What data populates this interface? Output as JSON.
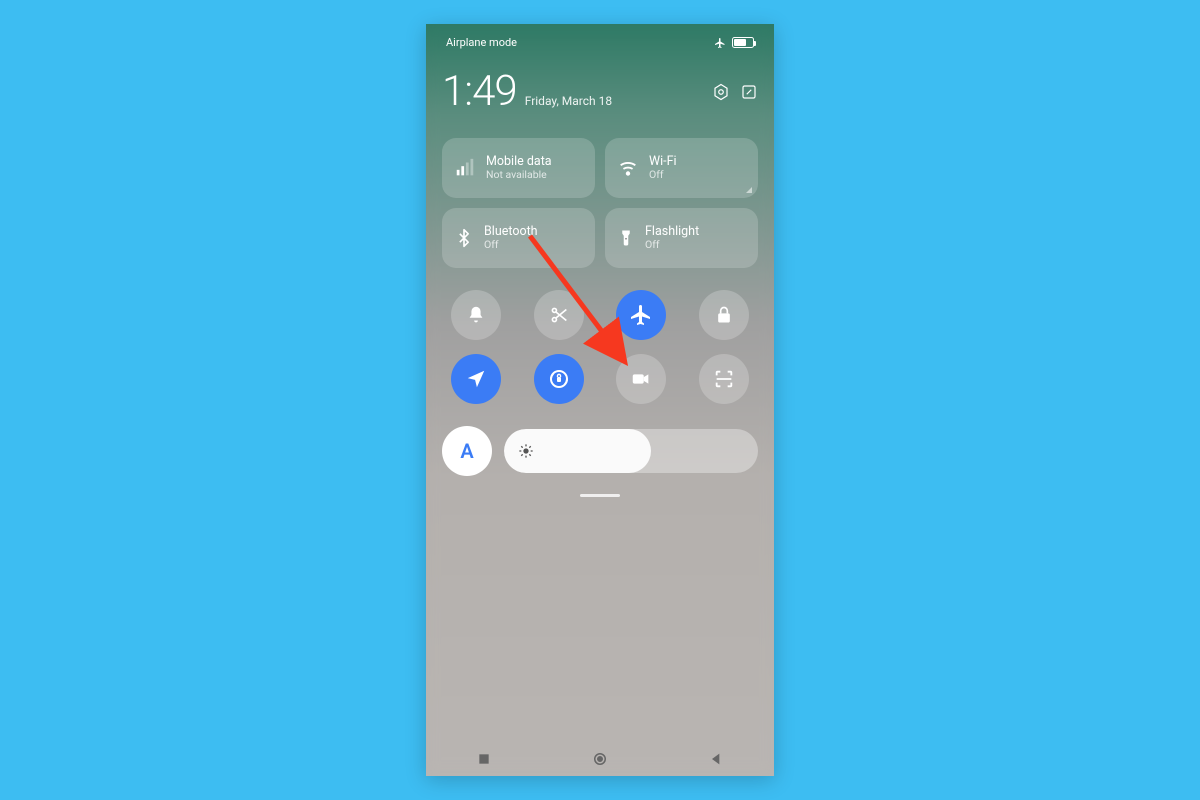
{
  "status": {
    "label": "Airplane mode",
    "battery_percent": 70
  },
  "clock": {
    "time": "1:49",
    "date": "Friday, March 18"
  },
  "tiles": {
    "mobile_data": {
      "label": "Mobile data",
      "sub": "Not available"
    },
    "wifi": {
      "label": "Wi-Fi",
      "sub": "Off"
    },
    "bluetooth": {
      "label": "Bluetooth",
      "sub": "Off"
    },
    "flashlight": {
      "label": "Flashlight",
      "sub": "Off"
    }
  },
  "round_toggles": [
    {
      "name": "mute",
      "icon": "bell",
      "active": false
    },
    {
      "name": "screenshot",
      "icon": "scissors",
      "active": false
    },
    {
      "name": "airplane-mode",
      "icon": "airplane",
      "active": true
    },
    {
      "name": "lock",
      "icon": "lock",
      "active": false
    },
    {
      "name": "location",
      "icon": "navigation",
      "active": true
    },
    {
      "name": "auto-rotate",
      "icon": "rotate-lock",
      "active": true
    },
    {
      "name": "screen-record",
      "icon": "video",
      "active": false
    },
    {
      "name": "scanner",
      "icon": "scan",
      "active": false
    }
  ],
  "brightness": {
    "auto_label": "A",
    "value_percent": 58
  },
  "colors": {
    "accent": "#3b7cf5",
    "annotation": "#f6381f",
    "page_bg": "#3dbdf2"
  }
}
